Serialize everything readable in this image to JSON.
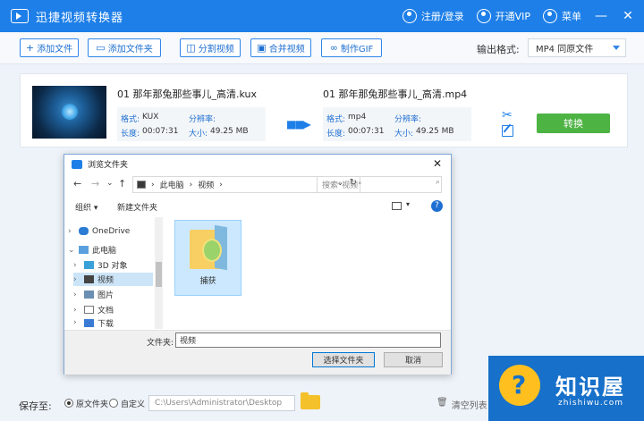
{
  "app": {
    "title": "迅捷视频转换器",
    "login": "注册/登录",
    "vip": "开通VIP",
    "menu": "菜单",
    "minimize": "—",
    "close": "✕"
  },
  "toolbar": {
    "add_file": "添加文件",
    "add_folder": "添加文件夹",
    "split_video": "分割视频",
    "merge_video": "合并视频",
    "make_gif": "制作GIF",
    "output_format_label": "输出格式:",
    "output_format_value": "MP4  同原文件"
  },
  "file": {
    "source_name": "01 那年那兔那些事儿_高清.kux",
    "source_format_label": "格式:",
    "source_format": "KUX",
    "source_res_label": "分辨率:",
    "source_res": "",
    "source_duration_label": "长度:",
    "source_duration": "00:07:31",
    "source_size_label": "大小:",
    "source_size": "49.25 MB",
    "target_name": "01 那年那兔那些事儿_高清.mp4",
    "target_format_label": "格式:",
    "target_format": "mp4",
    "target_res_label": "分辨率:",
    "target_res": "",
    "target_duration_label": "长度:",
    "target_duration": "00:07:31",
    "target_size_label": "大小:",
    "target_size": "49.25 MB",
    "convert": "转换"
  },
  "dialog": {
    "title": "浏览文件夹",
    "close": "✕",
    "breadcrumb": [
      "此电脑",
      "视频"
    ],
    "search_placeholder": "搜索\"视频\"",
    "organize": "组织 ▾",
    "new_folder": "新建文件夹",
    "tree": [
      {
        "label": "OneDrive",
        "expanded": false
      },
      {
        "label": "此电脑",
        "expanded": true
      },
      {
        "label": "3D 对象"
      },
      {
        "label": "视频",
        "selected": true
      },
      {
        "label": "图片"
      },
      {
        "label": "文档"
      },
      {
        "label": "下载"
      }
    ],
    "folder_item": "捕获",
    "filename_label": "文件夹:",
    "filename_value": "视频",
    "select_button": "选择文件夹",
    "cancel_button": "取消"
  },
  "bottom": {
    "save_to": "保存至:",
    "option_original": "原文件夹",
    "option_custom": "自定义",
    "path": "C:\\Users\\Administrator\\Desktop",
    "clear": "清空列表"
  },
  "watermark": {
    "name": "知识屋",
    "domain": "zhishiwu.com"
  },
  "colors": {
    "primary": "#1e7fe8",
    "convert_green": "#4db343",
    "badge_blue": "#1770c9",
    "badge_yellow": "#ffc01f"
  }
}
